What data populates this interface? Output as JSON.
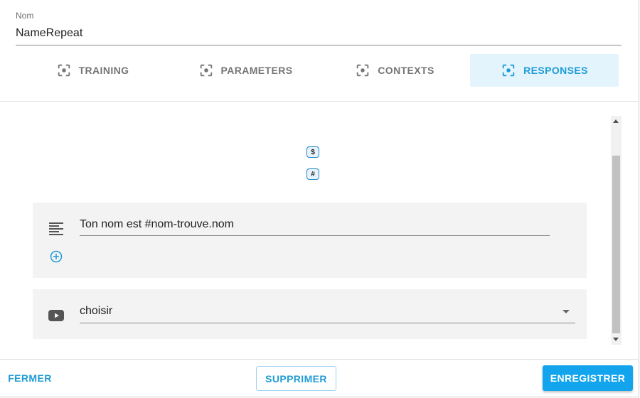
{
  "name_field": {
    "label": "Nom",
    "value": "NameRepeat"
  },
  "tabs": [
    {
      "label": "TRAINING",
      "icon": "center-focus-icon",
      "active": false
    },
    {
      "label": "PARAMETERS",
      "icon": "center-focus-icon",
      "active": false
    },
    {
      "label": "CONTEXTS",
      "icon": "center-focus-icon",
      "active": false
    },
    {
      "label": "RESPONSES",
      "icon": "center-focus-icon",
      "active": true
    }
  ],
  "badges": {
    "dollar": "$",
    "hash": "#"
  },
  "responses": {
    "text": {
      "icon": "text-lines-icon",
      "value": "Ton nom est #nom-trouve.nom",
      "add_icon": "add-circle-icon"
    },
    "video": {
      "icon": "video-icon",
      "selected": "choisir"
    }
  },
  "footer": {
    "close_label": "FERMER",
    "delete_label": "SUPPRIMER",
    "save_label": "ENREGISTRER"
  },
  "colors": {
    "accent": "#1e9bd7",
    "primary_button": "#12a5ee",
    "active_tab_bg": "#e3f4fd",
    "card_bg": "#f3f3f3"
  }
}
